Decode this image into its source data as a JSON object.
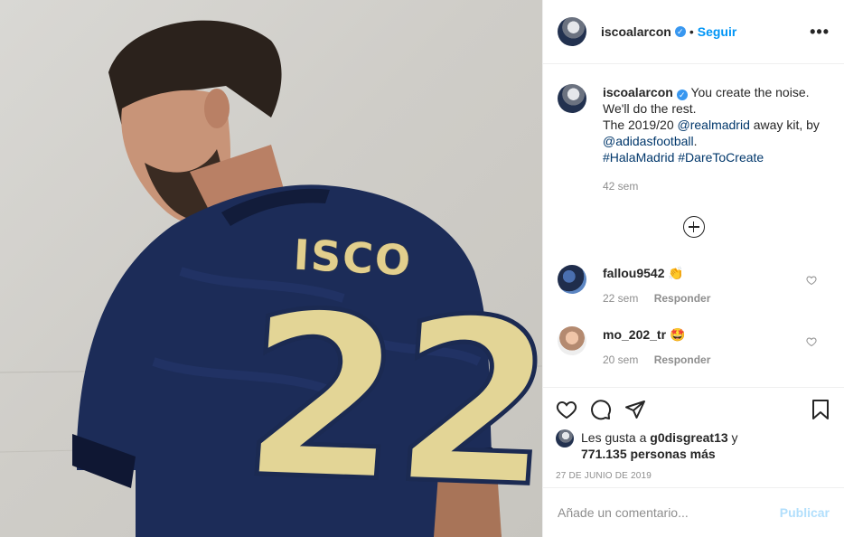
{
  "post": {
    "author": "iscoalarcon",
    "follow_label": "Seguir",
    "dot": "•",
    "more_label": "•••",
    "jersey_name": "ISCO",
    "jersey_number": "22"
  },
  "caption": {
    "username": "iscoalarcon",
    "line1": "You create the noise.",
    "line2": "We'll do the rest.",
    "line3_prefix": "The 2019/20",
    "mention1": "@realmadrid",
    "line3_suffix": "away kit, by",
    "mention2": "@adidasfootball",
    "mention2_suffix": ".",
    "tag1": "#HalaMadrid",
    "tag2": "#DareToCreate",
    "time": "42 sem"
  },
  "comments": [
    {
      "username": "fallou9542",
      "emoji": "👏",
      "time": "22 sem",
      "reply_label": "Responder"
    },
    {
      "username": "mo_202_tr",
      "emoji": "🤩",
      "time": "20 sem",
      "reply_label": "Responder"
    }
  ],
  "likes": {
    "prefix": "Les gusta a",
    "user": "g0disgreat13",
    "middle": "y",
    "count": "771.135 personas más"
  },
  "date": "27 DE JUNIO DE 2019",
  "composer": {
    "placeholder": "Añade un comentario...",
    "publish_label": "Publicar"
  },
  "colors": {
    "link": "#00376b",
    "follow": "#0095f6",
    "muted": "#8e8e8e",
    "publish_disabled": "#b2dffc"
  }
}
